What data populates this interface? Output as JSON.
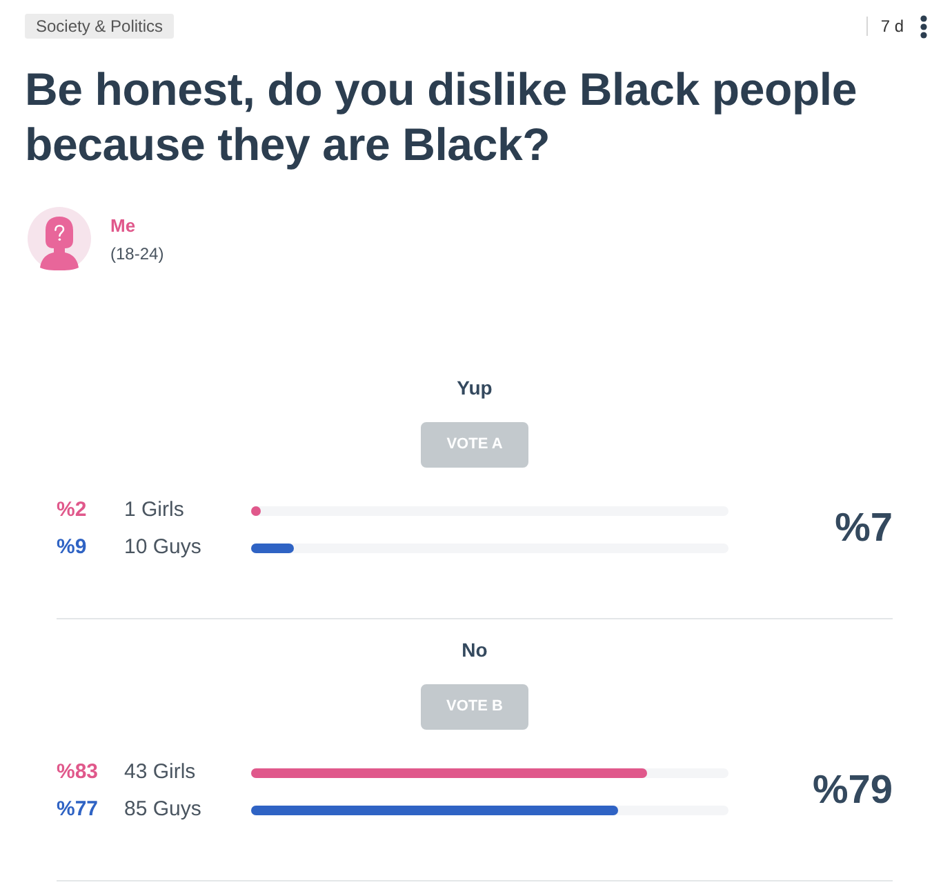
{
  "category": "Society & Politics",
  "age": "7 d",
  "question": "Be honest, do you dislike Black people because they are Black?",
  "author": {
    "name": "Me",
    "age_range": "(18-24)"
  },
  "options": [
    {
      "label": "Yup",
      "button": "VOTE A",
      "total": "%7",
      "groups": [
        {
          "percent": "%2",
          "count": "1 Girls",
          "level": 0.02,
          "color": "#e0588b"
        },
        {
          "percent": "%9",
          "count": "10 Guys",
          "level": 0.09,
          "color": "#2f63c4"
        }
      ]
    },
    {
      "label": "No",
      "button": "VOTE B",
      "total": "%79",
      "groups": [
        {
          "percent": "%83",
          "count": "43 Girls",
          "level": 0.83,
          "color": "#e0588b"
        },
        {
          "percent": "%77",
          "count": "85 Guys",
          "level": 0.77,
          "color": "#2f63c4"
        }
      ]
    }
  ]
}
